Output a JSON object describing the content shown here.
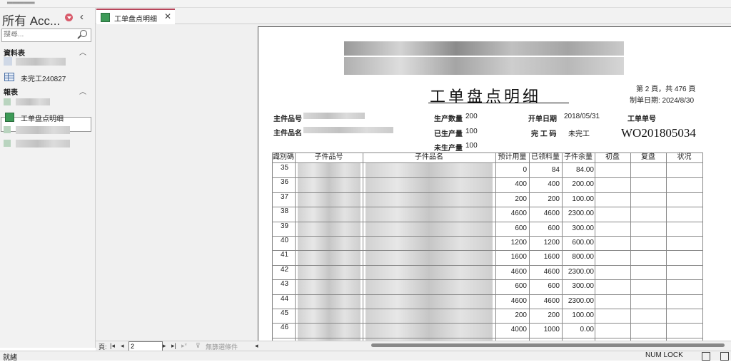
{
  "nav": {
    "title": "所有 Acc...",
    "search_placeholder": "搜尋...",
    "groups": [
      {
        "label": "資料表",
        "items": [
          "未完工240827"
        ]
      },
      {
        "label": "報表",
        "items": [
          "工单盘点明细"
        ]
      }
    ]
  },
  "tab": {
    "label": "工单盘点明细"
  },
  "report": {
    "title": "工单盘点明细",
    "page_info": "第 2 頁，共 476 頁",
    "print_date": "制单日期: 2024/8/30",
    "labels": {
      "main_part_no": "主件品号",
      "main_part_name": "主件品名",
      "prod_qty": "生产数量",
      "produced_qty": "已生产量",
      "unproduced_qty": "未生产量",
      "open_date": "开单日期",
      "status_code": "完 工 码",
      "wo_no": "工单单号"
    },
    "values": {
      "prod_qty": "200",
      "produced_qty": "100",
      "unproduced_qty": "100",
      "open_date": "2018/05/31",
      "status_code": "未完工",
      "wo_no": "WO201805034"
    },
    "columns": [
      "識別碼",
      "子件品号",
      "子件品名",
      "预计用量",
      "已领料量",
      "子件余量",
      "初盘",
      "复盘",
      "状况"
    ],
    "rows": [
      {
        "id": "35",
        "planned": "0",
        "issued": "84",
        "remaining": "84.00"
      },
      {
        "id": "36",
        "planned": "400",
        "issued": "400",
        "remaining": "200.00"
      },
      {
        "id": "37",
        "planned": "200",
        "issued": "200",
        "remaining": "100.00"
      },
      {
        "id": "38",
        "planned": "4600",
        "issued": "4600",
        "remaining": "2300.00"
      },
      {
        "id": "39",
        "planned": "600",
        "issued": "600",
        "remaining": "300.00"
      },
      {
        "id": "40",
        "planned": "1200",
        "issued": "1200",
        "remaining": "600.00"
      },
      {
        "id": "41",
        "planned": "1600",
        "issued": "1600",
        "remaining": "800.00"
      },
      {
        "id": "42",
        "planned": "4600",
        "issued": "4600",
        "remaining": "2300.00"
      },
      {
        "id": "43",
        "planned": "600",
        "issued": "600",
        "remaining": "300.00"
      },
      {
        "id": "44",
        "planned": "4600",
        "issued": "4600",
        "remaining": "2300.00"
      },
      {
        "id": "45",
        "planned": "200",
        "issued": "200",
        "remaining": "100.00"
      },
      {
        "id": "46",
        "planned": "4000",
        "issued": "1000",
        "remaining": "0.00"
      }
    ]
  },
  "record_nav": {
    "label": "頁:",
    "current": "2",
    "filter_label": "無篩選條件"
  },
  "status": {
    "left": "就緒",
    "numlock": "NUM LOCK"
  },
  "icons": [
    "search-icon",
    "table-icon",
    "report-icon",
    "close-icon",
    "dropdown-icon",
    "collapse-icon",
    "filter-icon"
  ]
}
